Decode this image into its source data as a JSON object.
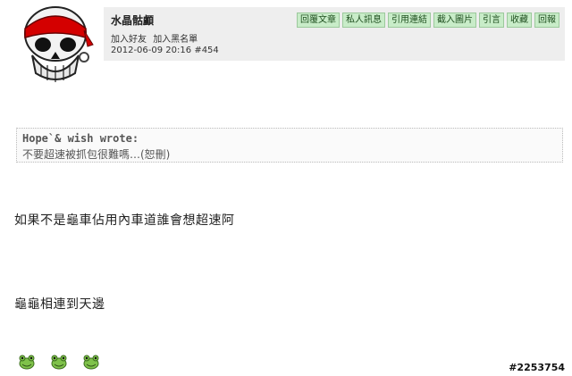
{
  "post": {
    "username": "水晶骷顱",
    "user_links": [
      "加入好友",
      "加入黑名單"
    ],
    "timestamp": "2012-06-09 20:16",
    "post_number": "#454",
    "actions": [
      "回覆文章",
      "私人訊息",
      "引用連結",
      "截入圖片",
      "引言",
      "收藏",
      "回報"
    ]
  },
  "quote": {
    "author": "Hope`& wish wrote:",
    "text": "不要超速被抓包很難嗎…(恕刪)"
  },
  "body": {
    "line1": "如果不是龜車佔用內車道誰會想超速阿",
    "line2": "龜龜相連到天邊"
  },
  "emoticons": [
    "frog-emoticon",
    "frog-emoticon",
    "frog-emoticon"
  ],
  "watermark": "#2253754",
  "colors": {
    "header_bg": "#eeeeee",
    "button_bg": "#c8ecc8",
    "avatar_red": "#d40000"
  }
}
